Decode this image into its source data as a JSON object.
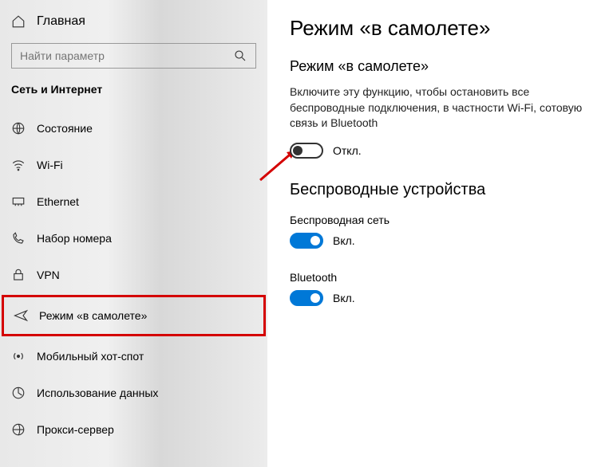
{
  "sidebar": {
    "home": "Главная",
    "search_placeholder": "Найти параметр",
    "section": "Сеть и Интернет",
    "items": [
      {
        "label": "Состояние"
      },
      {
        "label": "Wi-Fi"
      },
      {
        "label": "Ethernet"
      },
      {
        "label": "Набор номера"
      },
      {
        "label": "VPN"
      },
      {
        "label": "Режим «в самолете»"
      },
      {
        "label": "Мобильный хот-спот"
      },
      {
        "label": "Использование данных"
      },
      {
        "label": "Прокси-сервер"
      }
    ]
  },
  "main": {
    "title": "Режим «в самолете»",
    "sub": "Режим «в самолете»",
    "desc": "Включите эту функцию, чтобы остановить все беспроводные подключения, в частности Wi-Fi, сотовую связь и Bluetooth",
    "airplane_state": "Откл.",
    "wireless_heading": "Беспроводные устройства",
    "wifi_label": "Беспроводная сеть",
    "wifi_state": "Вкл.",
    "bt_label": "Bluetooth",
    "bt_state": "Вкл."
  }
}
